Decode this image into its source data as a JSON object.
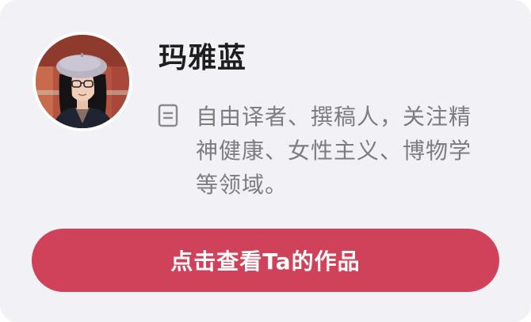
{
  "profile": {
    "name": "玛雅蓝",
    "bio": "自由译者、撰稿人，关注精神健康、女性主义、博物学等领域。",
    "avatar_icon": "avatar-photo",
    "bio_icon": "document-icon"
  },
  "action": {
    "label": "点击查看Ta的作品"
  },
  "colors": {
    "card_background": "#f1f1f6",
    "button_background": "#d0425a",
    "name_text": "#1e1e1e",
    "bio_text": "#7d7d80"
  }
}
